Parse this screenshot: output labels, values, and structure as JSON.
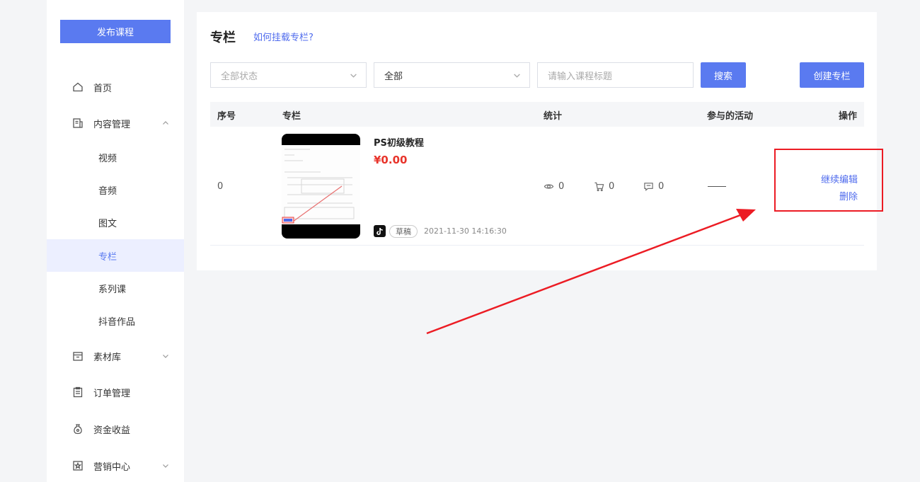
{
  "sidebar": {
    "publish_label": "发布课程",
    "items": [
      {
        "label": "首页",
        "icon": "home-icon"
      },
      {
        "label": "内容管理",
        "icon": "content-icon",
        "expanded": true
      },
      {
        "label": "素材库",
        "icon": "folder-icon"
      },
      {
        "label": "订单管理",
        "icon": "clipboard-icon"
      },
      {
        "label": "资金收益",
        "icon": "money-bag-icon"
      },
      {
        "label": "营销中心",
        "icon": "star-icon"
      }
    ],
    "sub_items": [
      "视频",
      "音频",
      "图文",
      "专栏",
      "系列课",
      "抖音作品"
    ],
    "active_sub": "专栏"
  },
  "main": {
    "title": "专栏",
    "help_link": "如何挂载专栏?",
    "filters": {
      "status_placeholder": "全部状态",
      "type_value": "全部",
      "search_placeholder": "请输入课程标题",
      "search_button": "搜索",
      "create_button": "创建专栏"
    },
    "table": {
      "headers": [
        "序号",
        "专栏",
        "统计",
        "参与的活动",
        "操作"
      ],
      "rows": [
        {
          "index": "0",
          "title": "PS初级教程",
          "price": "¥0.00",
          "status_tag": "草稿",
          "date": "2021-11-30 14:16:30",
          "views": "0",
          "purchases": "0",
          "comments": "0",
          "activity": "——",
          "actions": [
            "继续编辑",
            "删除"
          ]
        }
      ]
    }
  },
  "colors": {
    "accent": "#5a7af0",
    "link": "#4f6bed",
    "price": "#e8342b",
    "annotation": "#ec1c24"
  }
}
